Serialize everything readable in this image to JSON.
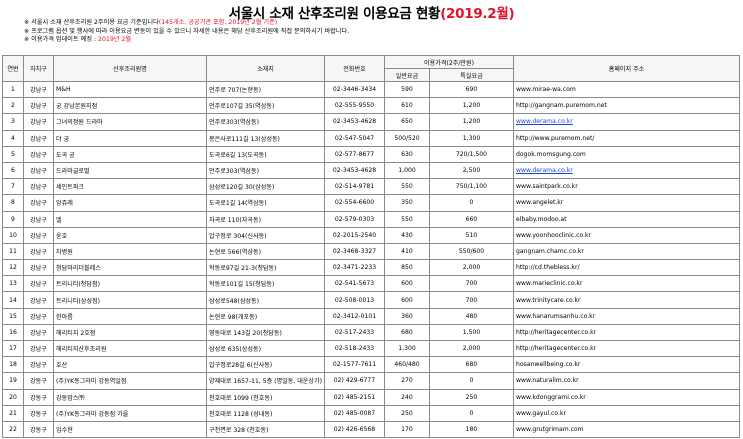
{
  "title": {
    "main": "서울시 소재 산후조리원 이용요금 현황",
    "highlight": "(2019.2월)"
  },
  "notes": [
    {
      "prefix": "※ 서울시 소재 산후조리원 2주이용 요금 기준입니다",
      "red": "(145개소, 공공기관 포함, 2019년 2월 기준)",
      "suffix": ""
    },
    {
      "prefix": "※ 프로그램 옵션 및 행사에 따라 이용요금 변동이 있을 수 있으니 자세한 내용은 해당 산후조리원에 직접 문의하시기 바랍니다.",
      "red": "",
      "suffix": ""
    },
    {
      "prefix": "※ 이용가격 업데이트 예정 : ",
      "red": "2019년 2월",
      "suffix": ""
    }
  ],
  "headers": {
    "no": "연번",
    "district": "자치구",
    "name": "산후조리원명",
    "address": "소재지",
    "phone": "전화번호",
    "price_group": "이용가격(2주/만원)",
    "general": "일반요금",
    "special": "특실요금",
    "homepage": "홈페이지 주소"
  },
  "rows": [
    {
      "no": "1",
      "district": "강남구",
      "name": "M&H",
      "address": "언주로 707(논현동)",
      "phone": "02-3446-3434",
      "general": "590",
      "special": "690",
      "homepage": "www.mirae-wa.com",
      "link": false
    },
    {
      "no": "2",
      "district": "강남구",
      "name": "궁 강남본원지점",
      "address": "언주로107길 35(역삼동)",
      "phone": "02-555-9550",
      "general": "610",
      "special": "1,200",
      "homepage": "http://gangnam.puremom.net",
      "link": false
    },
    {
      "no": "3",
      "district": "강남구",
      "name": "그녀의정원 드라마",
      "address": "언주로303(역삼동)",
      "phone": "02-3453-4628",
      "general": "650",
      "special": "1,200",
      "homepage": "www.derama.co.kr",
      "link": true
    },
    {
      "no": "4",
      "district": "강남구",
      "name": "더 궁",
      "address": "봉은사로111길 13(삼성동)",
      "phone": "02-547-5047",
      "general": "500/520",
      "special": "1,300",
      "homepage": "http://www.puremom.net/",
      "link": false
    },
    {
      "no": "5",
      "district": "강남구",
      "name": "도곡 궁",
      "address": "도곡로6길 13(도곡동)",
      "phone": "02-577-8677",
      "general": "630",
      "special": "720/1,500",
      "homepage": "dogok.momsgung.com",
      "link": false
    },
    {
      "no": "6",
      "district": "강남구",
      "name": "드라마글로벌",
      "address": "언주로303(역삼동)",
      "phone": "02-3453-4628",
      "general": "1,000",
      "special": "2,500",
      "homepage": "www.derama.co.kr",
      "link": true
    },
    {
      "no": "7",
      "district": "강남구",
      "name": "세인트파크",
      "address": "삼성로120길 30(삼성동)",
      "phone": "02-514-9781",
      "general": "550",
      "special": "750/1,100",
      "homepage": "www.saintpark.co.kr",
      "link": false
    },
    {
      "no": "8",
      "district": "강남구",
      "name": "앙쥬레",
      "address": "도곡로1길 14(역삼동)",
      "phone": "02-554-6600",
      "general": "350",
      "special": "0",
      "homepage": "www.angelet.kr",
      "link": false
    },
    {
      "no": "9",
      "district": "강남구",
      "name": "엘",
      "address": "자곡로 110(자곡동)",
      "phone": "02-579-0303",
      "general": "550",
      "special": "660",
      "homepage": "elbaby.modoo.at",
      "link": false
    },
    {
      "no": "10",
      "district": "강남구",
      "name": "윤호",
      "address": "압구정로 304(신사동)",
      "phone": "02-2015-2540",
      "general": "430",
      "special": "510",
      "homepage": "www.yoonhooclinic.co.kr",
      "link": false
    },
    {
      "no": "11",
      "district": "강남구",
      "name": "차병원",
      "address": "논현로 566(역삼동)",
      "phone": "02-3468-3327",
      "general": "410",
      "special": "550/600",
      "homepage": "gangnam.chamc.co.kr",
      "link": false
    },
    {
      "no": "12",
      "district": "강남구",
      "name": "청담마리더블레스",
      "address": "학동로97길 21-3(청담동)",
      "phone": "02-3471-2233",
      "general": "850",
      "special": "2,000",
      "homepage": "http://cd.thebless.kr/",
      "link": false
    },
    {
      "no": "13",
      "district": "강남구",
      "name": "트리니티(청담점)",
      "address": "학동로101길 15(청담동)",
      "phone": "02-541-5673",
      "general": "600",
      "special": "700",
      "homepage": "www.marieclinic.co.kr",
      "link": false
    },
    {
      "no": "14",
      "district": "강남구",
      "name": "트리니티(삼성점)",
      "address": "삼성로548(삼성동)",
      "phone": "02-508-0013",
      "general": "600",
      "special": "700",
      "homepage": "www.trinitycare.co.kr",
      "link": false
    },
    {
      "no": "15",
      "district": "강남구",
      "name": "한아름",
      "address": "논현로 98(개포동)",
      "phone": "02-3412-0101",
      "general": "360",
      "special": "480",
      "homepage": "www.hanarumsanhu.co.kr",
      "link": false
    },
    {
      "no": "16",
      "district": "강남구",
      "name": "헤리티지 2호점",
      "address": "영동대로 143길 20(청담동)",
      "phone": "02-517-2433",
      "general": "680",
      "special": "1,500",
      "homepage": "http://heritagecenter.co.kr",
      "link": false
    },
    {
      "no": "17",
      "district": "강남구",
      "name": "헤리티지산후조리원",
      "address": "삼성로 635(삼성동)",
      "phone": "02-518-2433",
      "general": "1,300",
      "special": "2,000",
      "homepage": "http://heritagecenter.co.kr",
      "link": false
    },
    {
      "no": "18",
      "district": "강남구",
      "name": "호산",
      "address": "압구정로28길 6(신사동)",
      "phone": "02-1577-7611",
      "general": "460/480",
      "special": "680",
      "homepage": "hosanwellbeing.co.kr",
      "link": false
    },
    {
      "no": "19",
      "district": "강동구",
      "name": "(주)YK동그라미 강동역일점",
      "address": "양재대로 1657-11, 5층 (명일동, 대운상가)",
      "phone": "02) 429-6777",
      "general": "270",
      "special": "0",
      "homepage": "www.naturalim.co.kr",
      "link": false
    },
    {
      "no": "20",
      "district": "강동구",
      "name": "강동맘스㈜",
      "address": "천호대로 1099 (천호동)",
      "phone": "02) 485-2151",
      "general": "240",
      "special": "250",
      "homepage": "www.kdonggrami.co.kr",
      "link": false
    },
    {
      "no": "21",
      "district": "강동구",
      "name": "(주)YK동그라미 강동점 가을",
      "address": "천호대로 1128 (성내동)",
      "phone": "02) 485-0087",
      "general": "250",
      "special": "0",
      "homepage": "www.gayul.co.kr",
      "link": false
    },
    {
      "no": "22",
      "district": "강동구",
      "name": "임수현",
      "address": "구천면로 328 (천호동)",
      "phone": "02) 426-6568",
      "general": "170",
      "special": "180",
      "homepage": "www.grutgrimam.com",
      "link": false
    }
  ]
}
